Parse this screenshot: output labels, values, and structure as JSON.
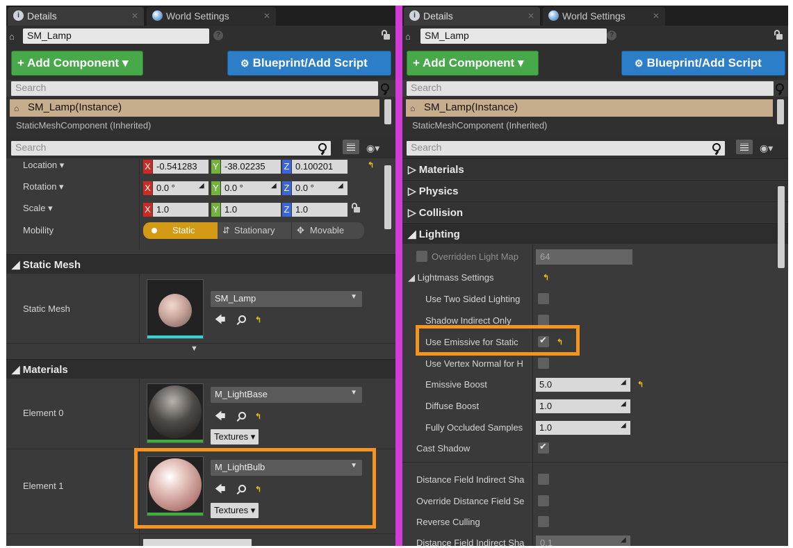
{
  "left": {
    "tabs": [
      {
        "label": "Details",
        "active": true
      },
      {
        "label": "World Settings",
        "active": false
      }
    ],
    "actor_name": "SM_Lamp",
    "add_component": "+ Add Component ▾",
    "blueprint": "Blueprint/Add Script",
    "search_placeholder": "Search",
    "tree_selected": "SM_Lamp(Instance)",
    "tree_sub": "StaticMeshComponent (Inherited)",
    "search2_placeholder": "Search",
    "transform": {
      "location_label": "Location ▾",
      "rotation_label": "Rotation ▾",
      "scale_label": "Scale ▾",
      "mobility_label": "Mobility",
      "loc_x": "-0.541283",
      "loc_y": "-38.02235",
      "loc_z": "0.100201",
      "rot_x": "0.0 °",
      "rot_y": "0.0 °",
      "rot_z": "0.0 °",
      "scale_x": "1.0",
      "scale_y": "1.0",
      "scale_z": "1.0",
      "axis_x": "X",
      "axis_y": "Y",
      "axis_z": "Z",
      "mobility_static": "Static",
      "mobility_stationary": "Stationary",
      "mobility_movable": "Movable"
    },
    "static_mesh_section": "◢ Static Mesh",
    "static_mesh_label": "Static Mesh",
    "static_mesh_value": "SM_Lamp",
    "materials_section": "◢ Materials",
    "element0_label": "Element 0",
    "element0_value": "M_LightBase",
    "element1_label": "Element 1",
    "element1_value": "M_LightBulb",
    "textures_label": "Textures ▾"
  },
  "right": {
    "tabs": [
      {
        "label": "Details",
        "active": true
      },
      {
        "label": "World Settings",
        "active": false
      }
    ],
    "actor_name": "SM_Lamp",
    "add_component": "+ Add Component ▾",
    "blueprint": "Blueprint/Add Script",
    "search_placeholder": "Search",
    "tree_selected": "SM_Lamp(Instance)",
    "tree_sub": "StaticMeshComponent (Inherited)",
    "search2_placeholder": "Search",
    "sections": {
      "materials": "▷ Materials",
      "physics": "▷ Physics",
      "collision": "▷ Collision",
      "lighting": "◢ Lighting"
    },
    "overridden_light_map": "Overridden Light Map",
    "overridden_value": "64",
    "lightmass_settings": "◢ Lightmass Settings",
    "use_two_sided": "Use Two Sided Lighting",
    "shadow_indirect_only": "Shadow Indirect Only",
    "use_emissive": "Use Emissive for Static",
    "use_vertex_normal": "Use Vertex Normal for H",
    "emissive_boost_label": "Emissive Boost",
    "emissive_boost_value": "5.0",
    "diffuse_boost_label": "Diffuse Boost",
    "diffuse_boost_value": "1.0",
    "fully_occluded_label": "Fully Occluded Samples",
    "fully_occluded_value": "1.0",
    "cast_shadow": "Cast Shadow",
    "distance_field_indirect": "Distance Field Indirect Sha",
    "override_distance_field": "Override Distance Field Se",
    "reverse_culling": "Reverse Culling",
    "distance_field_indirect2": "Distance Field Indirect Sha",
    "distance_field_indirect2_value": "0.1"
  },
  "colors": {
    "accent_orange": "#f39520",
    "divider_magenta": "#d43ad8",
    "add_green": "#47a94a",
    "blueprint_blue": "#2b7ec7",
    "static_gold": "#d39a16"
  }
}
